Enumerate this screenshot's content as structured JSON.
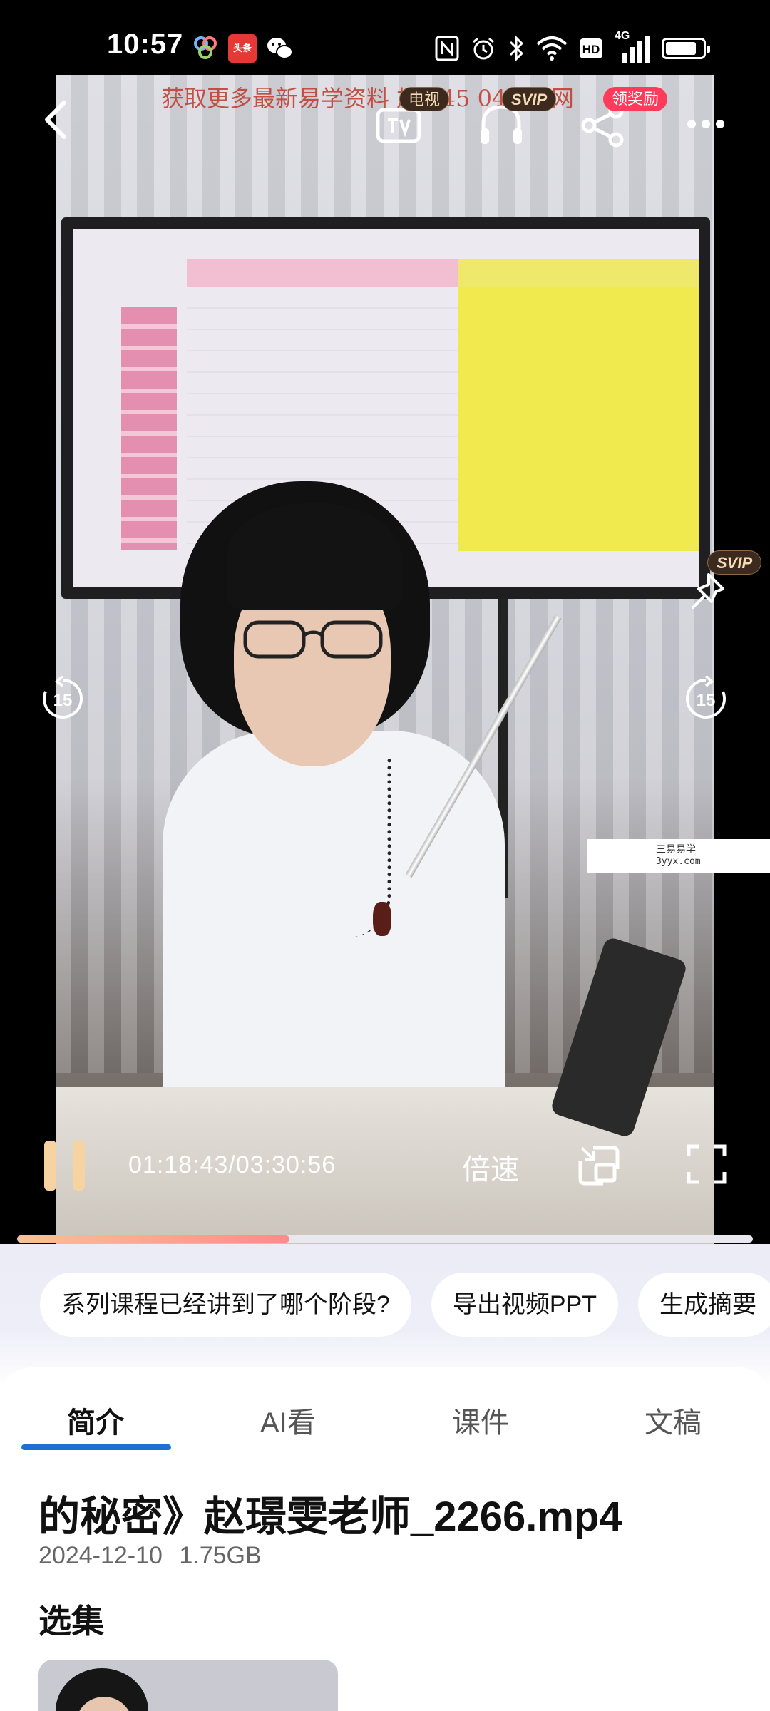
{
  "status_bar": {
    "time": "10:57",
    "network": "4G",
    "battery_level": 0.85,
    "icons": [
      "nfc-icon",
      "alarm-icon",
      "bluetooth-icon",
      "wifi-icon",
      "hd-icon",
      "signal-icon",
      "battery-icon"
    ],
    "app_icons": [
      "app-icon-pinwheel",
      "app-icon-toutiao",
      "app-icon-wechat"
    ],
    "toutiao_label": "头条"
  },
  "video": {
    "watermark_top": "获取更多最新易学资料 加 345 044 巴网",
    "side_watermark": {
      "name": "三易易学",
      "url": "3yyx.com"
    },
    "badges": {
      "tv": "电视",
      "svip_audio": "SVIP",
      "reward": "领奖励",
      "svip_pin": "SVIP"
    },
    "skip_back": "15",
    "skip_forward": "15",
    "time_display": "01:18:43/03:30:56",
    "speed_label": "倍速",
    "progress": 0.37
  },
  "chips": [
    "系列课程已经讲到了哪个阶段?",
    "导出视频PPT",
    "生成摘要"
  ],
  "tabs": [
    {
      "label": "简介",
      "active": true
    },
    {
      "label": "AI看",
      "active": false
    },
    {
      "label": "课件",
      "active": false
    },
    {
      "label": "文稿",
      "active": false
    }
  ],
  "file": {
    "title": "的秘密》赵璟雯老师_2266.mp4",
    "date": "2024-12-10",
    "size": "1.75GB"
  },
  "episodes_label": "选集",
  "colors": {
    "accent": "#1d6fd6",
    "pause": "#f6d3a0",
    "reward": "#ff3b5c",
    "svip": "#3b2a1d"
  }
}
